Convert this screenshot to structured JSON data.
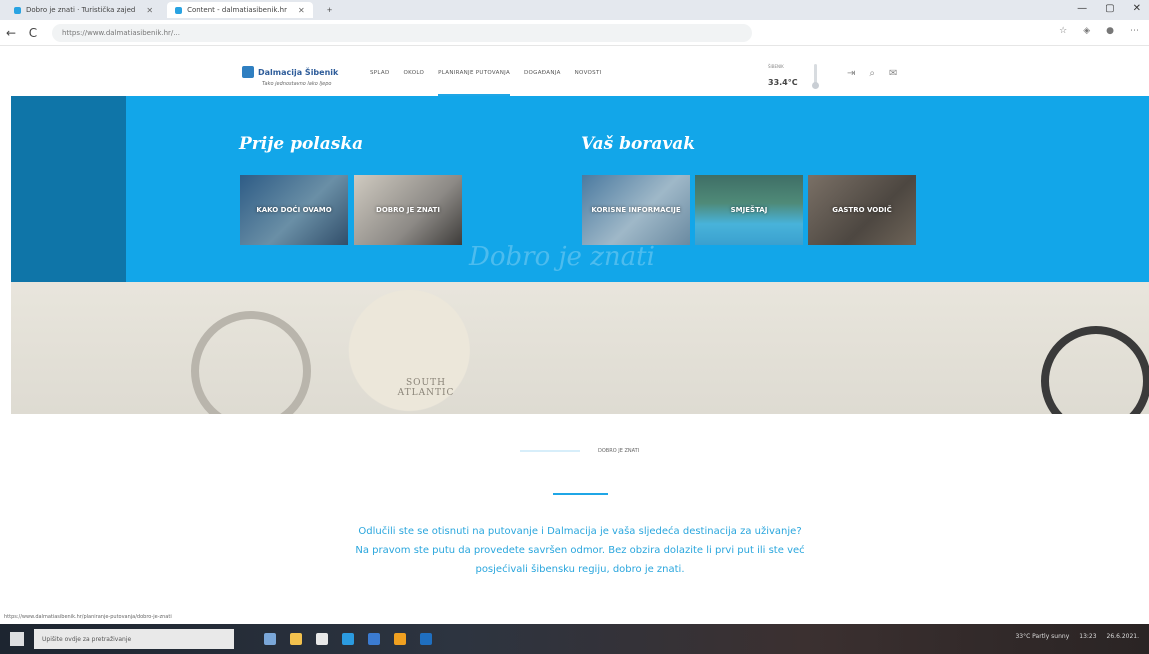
{
  "browser": {
    "tabs": [
      {
        "label": "Dobro je znati · Turistička zajed"
      },
      {
        "label": "Content - dalmatiasibenik.hr"
      }
    ],
    "new_tab": "+",
    "window_controls": [
      "—",
      "▢",
      "✕"
    ],
    "url": "https://www.dalmatiasibenik.hr/...",
    "back": "←",
    "reload": "C"
  },
  "header": {
    "logo_text": "Dalmacija Šibenik",
    "logo_tagline": "Tako jednostavno lako ljepo",
    "nav": [
      "SPLAD",
      "OKOLO",
      "PLANIRANJE PUTOVANJA",
      "DOGAĐANJA",
      "NOVOSTI"
    ],
    "weather_label": "ŠIBENIK",
    "temperature": "33.4°C"
  },
  "hero": {
    "left_title": "Prije polaska",
    "right_title": "Vaš boravak",
    "cards_left": [
      "KAKO DOĆI OVAMO",
      "DOBRO JE ZNATI"
    ],
    "cards_right": [
      "KORISNE INFORMACIJE",
      "SMJEŠTAJ",
      "GASTRO VODIČ"
    ],
    "watermark": "Dobro je znati",
    "map_labels": [
      "SOUTH ATLANTIC"
    ]
  },
  "content": {
    "breadcrumb": "DOBRO JE ZNATI",
    "intro": "Odlučili ste se otisnuti na putovanje i Dalmacija je vaša sljedeća destinacija za uživanje? Na pravom ste putu da provedete savršen odmor. Bez obzira dolazite li prvi put ili ste već posjećivali šibensku regiju, dobro je znati."
  },
  "status": "https://www.dalmatiasibenik.hr/planiranje-putovanja/dobro-je-znati",
  "taskbar": {
    "search_placeholder": "Upišite ovdje za pretraživanje",
    "weather": "33°C Partly sunny",
    "time": "13:23",
    "date": "26.6.2021."
  },
  "colors": {
    "accent": "#12a6e9",
    "text_blue": "#2aa6dd"
  }
}
